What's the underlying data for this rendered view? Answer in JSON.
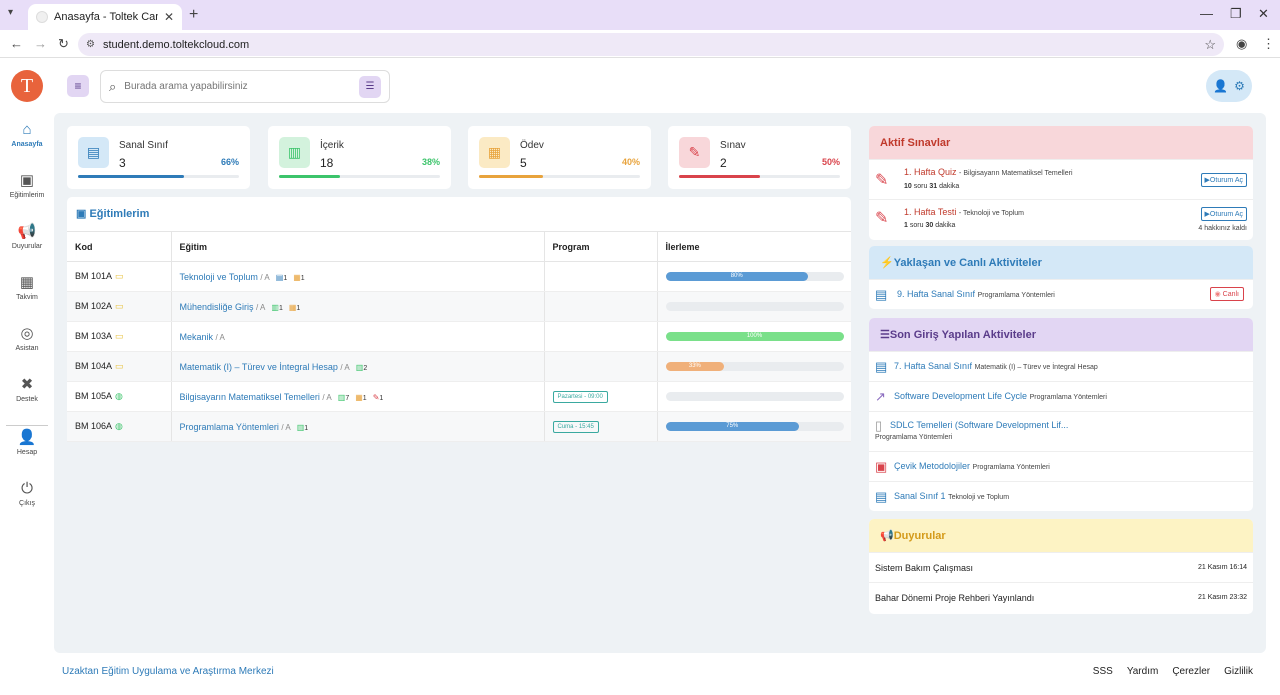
{
  "browser": {
    "tab_title": "Anasayfa - Toltek CampusDemo",
    "url": "student.demo.toltekcloud.com"
  },
  "sidebar": {
    "logo_letter": "T",
    "items": [
      {
        "label": "Anasayfa",
        "icon": "home-icon"
      },
      {
        "label": "Eğitimlerim",
        "icon": "book-icon"
      },
      {
        "label": "Duyurular",
        "icon": "megaphone-icon"
      },
      {
        "label": "Takvim",
        "icon": "calendar-icon"
      },
      {
        "label": "Asistan",
        "icon": "assistant-icon"
      },
      {
        "label": "Destek",
        "icon": "support-icon"
      },
      {
        "label": "Hesap",
        "icon": "user-icon"
      },
      {
        "label": "Çıkış",
        "icon": "power-icon"
      }
    ]
  },
  "search": {
    "placeholder": "Burada arama yapabilirsiniz"
  },
  "stats": [
    {
      "label": "Sanal Sınıf",
      "value": "3",
      "percent": "66%",
      "fraction": 0.66,
      "color": "#2e7bb8",
      "bg": "#d4e8f7"
    },
    {
      "label": "İçerik",
      "value": "18",
      "percent": "38%",
      "fraction": 0.38,
      "color": "#3cc46b",
      "bg": "#d3f2dd"
    },
    {
      "label": "Ödev",
      "value": "5",
      "percent": "40%",
      "fraction": 0.4,
      "color": "#e8a33c",
      "bg": "#fbeac4"
    },
    {
      "label": "Sınav",
      "value": "2",
      "percent": "50%",
      "fraction": 0.5,
      "color": "#d9434b",
      "bg": "#f8d7da"
    }
  ],
  "trainings": {
    "title": "Eğitimlerim",
    "columns": [
      "Kod",
      "Eğitim",
      "Program",
      "İlerleme"
    ],
    "rows": [
      {
        "code": "BM 101A",
        "name": "Teknoloji ve Toplum",
        "group": "/ A",
        "badges": [
          {
            "icon": "class-icon",
            "count": "1"
          },
          {
            "icon": "homework-icon",
            "count": "1"
          }
        ],
        "program": "",
        "progress": 0.8,
        "progress_label": "80%",
        "progress_color": "#5b9bd5"
      },
      {
        "code": "BM 102A",
        "name": "Mühendisliğe Giriş",
        "group": "/ A",
        "badges": [
          {
            "icon": "content-icon",
            "count": "1"
          },
          {
            "icon": "homework-icon",
            "count": "1"
          }
        ],
        "program": "",
        "progress": 0,
        "progress_label": "",
        "progress_color": "#5b9bd5"
      },
      {
        "code": "BM 103A",
        "name": "Mekanik",
        "group": "/ A",
        "badges": [],
        "program": "",
        "progress": 1.0,
        "progress_label": "100%",
        "progress_color": "#7ae08a"
      },
      {
        "code": "BM 104A",
        "name": "Matematik (I) – Türev ve İntegral Hesap",
        "group": "/ A",
        "badges": [
          {
            "icon": "content-icon",
            "count": "2"
          }
        ],
        "program": "",
        "progress": 0.33,
        "progress_label": "33%",
        "progress_color": "#f0b07a"
      },
      {
        "code": "BM 105A",
        "name": "Bilgisayarın Matematiksel Temelleri",
        "group": "/ A",
        "badges": [
          {
            "icon": "content-icon",
            "count": "7"
          },
          {
            "icon": "homework-icon",
            "count": "1"
          },
          {
            "icon": "exam-icon",
            "count": "1"
          }
        ],
        "program": "Pazartesi - 09:00",
        "progress": 0,
        "progress_label": "",
        "progress_color": "#5b9bd5"
      },
      {
        "code": "BM 106A",
        "name": "Programlama Yöntemleri",
        "group": "/ A",
        "badges": [
          {
            "icon": "content-icon",
            "count": "1"
          }
        ],
        "program": "Cuma - 15:45",
        "progress": 0.75,
        "progress_label": "75%",
        "progress_color": "#5b9bd5"
      }
    ]
  },
  "active_exams": {
    "title": "Aktif Sınavlar",
    "items": [
      {
        "title": "1. Hafta Quiz",
        "course": "- Bilgisayarın Matematiksel Temelleri",
        "q": "10",
        "q_label": "soru",
        "min": "31",
        "min_label": "dakika",
        "button": "▶Oturum Aç",
        "note": ""
      },
      {
        "title": "1. Hafta Testi",
        "course": "- Teknoloji ve Toplum",
        "q": "1",
        "q_label": "soru",
        "min": "30",
        "min_label": "dakika",
        "button": "▶Oturum Aç",
        "note": "4 hakkınız kaldı"
      }
    ]
  },
  "upcoming": {
    "title": "Yaklaşan ve Canlı Aktiviteler",
    "items": [
      {
        "title": "9. Hafta Sanal Sınıf",
        "course": "Programlama Yöntemleri",
        "badge": "Canlı"
      }
    ]
  },
  "recent": {
    "title": "Son Giriş Yapılan Aktiviteler",
    "items": [
      {
        "title": "7. Hafta Sanal Sınıf",
        "course": "Matematik (I) – Türev ve İntegral Hesap",
        "icon": "class-icon"
      },
      {
        "title": "Software Development Life Cycle",
        "course": "Programlama Yöntemleri",
        "icon": "link-icon"
      },
      {
        "title": "SDLC Temelleri (Software Development Lif...",
        "course": "Programlama Yöntemleri",
        "icon": "document-icon"
      },
      {
        "title": "Çevik Metodolojiler",
        "course": "Programlama Yöntemleri",
        "icon": "pdf-icon"
      },
      {
        "title": "Sanal Sınıf 1",
        "course": "Teknoloji ve Toplum",
        "icon": "class-icon"
      }
    ]
  },
  "announcements": {
    "title": "Duyurular",
    "items": [
      {
        "title": "Sistem Bakım Çalışması",
        "date": "21 Kasım 16:14"
      },
      {
        "title": "Bahar Dönemi Proje Rehberi Yayınlandı",
        "date": "21 Kasım 23:32"
      }
    ]
  },
  "footer": {
    "left": "Uzaktan Eğitim Uygulama ve Araştırma Merkezi",
    "links": [
      "SSS",
      "Yardım",
      "Çerezler",
      "Gizlilik"
    ]
  }
}
